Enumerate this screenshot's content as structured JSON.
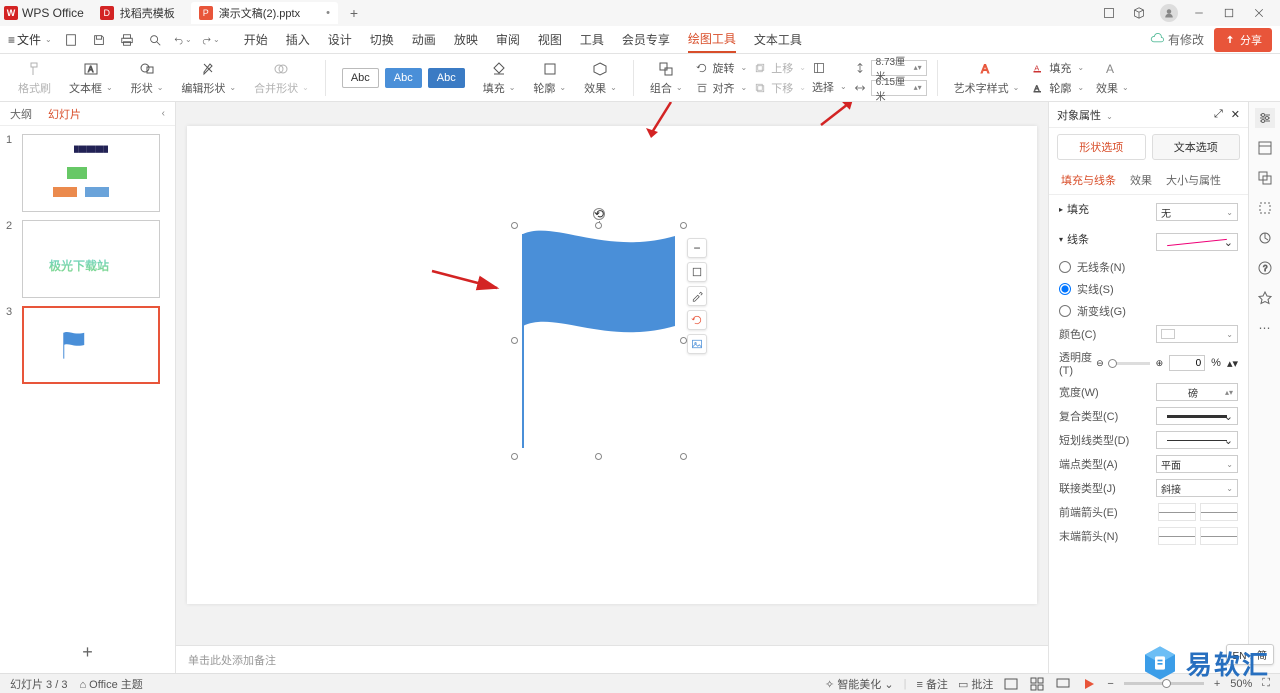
{
  "titlebar": {
    "app_name": "WPS Office",
    "tabs": [
      {
        "icon": "D",
        "label": "找稻壳模板"
      },
      {
        "icon": "P",
        "label": "演示文稿(2).pptx",
        "active": true
      }
    ]
  },
  "menubar": {
    "file": "文件",
    "items": [
      "开始",
      "插入",
      "设计",
      "切换",
      "动画",
      "放映",
      "审阅",
      "视图",
      "工具",
      "会员专享",
      "绘图工具",
      "文本工具"
    ],
    "active": "绘图工具",
    "sync": "有修改",
    "share": "分享"
  },
  "ribbon": {
    "format_painter": "格式刷",
    "textbox": "文本框",
    "shape": "形状",
    "edit_shape": "编辑形状",
    "merge_shapes": "合并形状",
    "abc": [
      "Abc",
      "Abc",
      "Abc"
    ],
    "fill": "填充",
    "outline": "轮廓",
    "effects": "效果",
    "group": "组合",
    "rotate": "旋转",
    "align": "对齐",
    "up": "上移",
    "down": "下移",
    "select": "选择",
    "height": "8.73厘米",
    "width": "6.15厘米",
    "art": "艺术字样式",
    "fill2": "填充",
    "outline2": "轮廓",
    "effects2": "效果"
  },
  "slidepanel": {
    "tabs": [
      "大纲",
      "幻灯片"
    ],
    "thumb2_text": "极光下载站"
  },
  "notes_placeholder": "单击此处添加备注",
  "props": {
    "title": "对象属性",
    "tab_shape": "形状选项",
    "tab_text": "文本选项",
    "sub": [
      "填充与线条",
      "效果",
      "大小与属性"
    ],
    "sec_fill": "填充",
    "fill_val": "无",
    "sec_line": "线条",
    "r_noline": "无线条(N)",
    "r_solid": "实线(S)",
    "r_grad": "渐变线(G)",
    "color": "颜色(C)",
    "opacity": "透明度(T)",
    "opacity_val": "0",
    "pct": "%",
    "widthw": "宽度(W)",
    "width_unit": "磅",
    "compound": "复合类型(C)",
    "dash": "短划线类型(D)",
    "cap": "端点类型(A)",
    "cap_val": "平面",
    "join": "联接类型(J)",
    "join_val": "斜接",
    "arrow_start": "前端箭头(E)",
    "arrow_end": "末端箭头(N)"
  },
  "status": {
    "page": "幻灯片 3 / 3",
    "theme": "Office 主题",
    "beautify": "智能美化",
    "notes": "备注",
    "comments": "批注",
    "zoom": "50%",
    "lang": "EN ♪ 简"
  },
  "wm": "易软汇"
}
